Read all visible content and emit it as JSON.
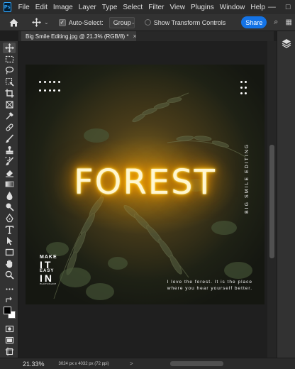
{
  "app": {
    "logo": "Ps"
  },
  "menu": [
    "File",
    "Edit",
    "Image",
    "Layer",
    "Type",
    "Select",
    "Filter",
    "View",
    "Plugins",
    "Window",
    "Help"
  ],
  "window_controls": {
    "minimize": "—",
    "maximize": "□",
    "close": "✕"
  },
  "options": {
    "auto_select_label": "Auto-Select:",
    "auto_select_checked": true,
    "target_value": "Group",
    "transform_controls_label": "Show Transform Controls",
    "share_label": "Share"
  },
  "document": {
    "tab_title": "Big Smile Editing.jpg @ 21.3% (RGB/8) *",
    "close": "×"
  },
  "artwork": {
    "title": "FOREST",
    "vertical_text": "BIG SMILE EDITING",
    "logo_line1": "MAKE",
    "logo_line2": "IT",
    "logo_line3": "EASY",
    "logo_line4": "IN",
    "logo_line5": "PHOTOSHOP",
    "quote_line1": "I love the forest. It is the place",
    "quote_line2": "where you hear yourself better.",
    "glow_color": "#ffa400"
  },
  "status": {
    "zoom": "21.33%",
    "doc_info": "3024 px x 4032 px (72 ppi)",
    "arrow": ">"
  },
  "colors": {
    "accent": "#1473e6",
    "foreground_swatch": "#000000",
    "background_swatch": "#ffffff"
  }
}
